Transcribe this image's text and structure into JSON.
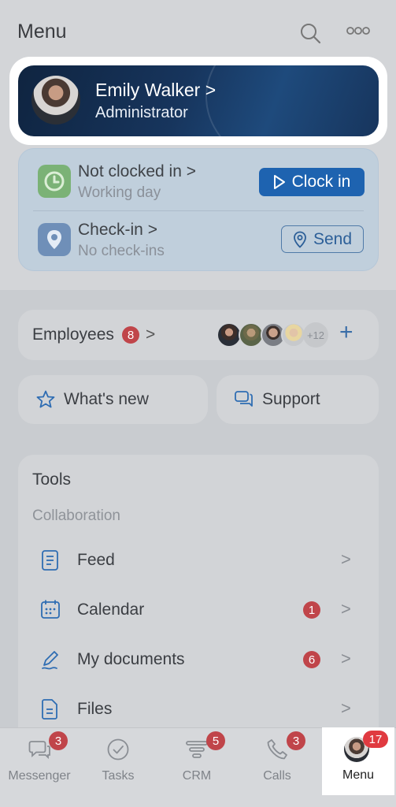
{
  "header": {
    "title": "Menu",
    "search_icon": "search-icon",
    "more_icon": "more-icon"
  },
  "profile": {
    "name": "Emily Walker",
    "chevron": ">",
    "role": "Administrator"
  },
  "clock": {
    "title": "Not clocked in",
    "chevron": ">",
    "subtitle": "Working day",
    "button": "Clock in"
  },
  "checkin": {
    "title": "Check-in",
    "chevron": ">",
    "subtitle": "No check-ins",
    "button": "Send"
  },
  "employees": {
    "label": "Employees",
    "badge": "8",
    "chevron": ">",
    "more": "+12",
    "add": "+"
  },
  "whats_new": {
    "label": "What's new"
  },
  "support": {
    "label": "Support"
  },
  "tools": {
    "title": "Tools",
    "section": "Collaboration",
    "items": [
      {
        "label": "Feed",
        "badge": "",
        "chevron": ">"
      },
      {
        "label": "Calendar",
        "badge": "1",
        "chevron": ">"
      },
      {
        "label": "My documents",
        "badge": "6",
        "chevron": ">"
      },
      {
        "label": "Files",
        "badge": "",
        "chevron": ">"
      }
    ]
  },
  "nav": {
    "items": [
      {
        "label": "Messenger",
        "badge": "3"
      },
      {
        "label": "Tasks",
        "badge": ""
      },
      {
        "label": "CRM",
        "badge": "5"
      },
      {
        "label": "Calls",
        "badge": "3"
      },
      {
        "label": "Menu",
        "badge": "17"
      }
    ]
  },
  "colors": {
    "accent": "#1e63b0",
    "badge": "#c0454a",
    "profile_bg": "#17355d"
  }
}
